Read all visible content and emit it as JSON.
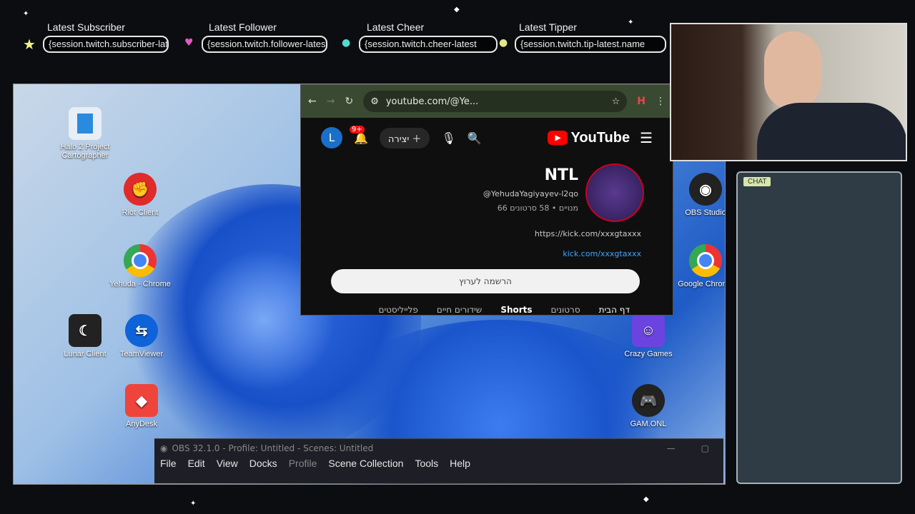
{
  "overlay": {
    "alerts": [
      {
        "title": "Latest Subscriber",
        "value": "{session.twitch.subscriber-latest"
      },
      {
        "title": "Latest Follower",
        "value": "{session.twitch.follower-latest"
      },
      {
        "title": "Latest Cheer",
        "value": "{session.twitch.cheer-latest"
      },
      {
        "title": "Latest Tipper",
        "value": "{session.twitch.tip-latest.name"
      }
    ],
    "accent": "#ffffff"
  },
  "desktop": {
    "icons_left": [
      {
        "label": "Halo 2 Project Cartographer",
        "icon": "halo-icon"
      },
      {
        "label": "Riot Client",
        "icon": "riot-icon"
      },
      {
        "label": "Yehuda - Chrome",
        "icon": "chrome-icon"
      },
      {
        "label": "TeamViewer",
        "icon": "teamviewer-icon"
      },
      {
        "label": "AnyDesk",
        "icon": "anydesk-icon"
      },
      {
        "label": "Lunar Client",
        "icon": "lunar-icon"
      }
    ],
    "icons_right": [
      {
        "label": "OBS Studio",
        "icon": "obs-icon"
      },
      {
        "label": "Google Chrome",
        "icon": "chrome-icon"
      },
      {
        "label": "Crazy Games",
        "icon": "crazygames-icon"
      },
      {
        "label": "GAM.ONL",
        "icon": "gamonl-icon"
      }
    ]
  },
  "browser": {
    "url": "youtube.com/@Ye...",
    "channel_name": "NTL",
    "handle": "@YehudaYagiyayev-l2qo",
    "stats": "66 מנויים • 58 סרטונים",
    "link1": "https://kick.com/xxxgtaxxx",
    "link2": "kick.com/xxxgtaxxx",
    "subscribe_label": "הרשמה לערוץ",
    "create_label": "יצירה",
    "notif_count": "9+",
    "avatar_letter": "L",
    "tabs": [
      "דף הבית",
      "סרטונים",
      "Shorts",
      "שידורים חיים",
      "פלייליסטים"
    ]
  },
  "chat": {
    "label": "CHAT"
  },
  "obs": {
    "title": "OBS 32.1.0 - Profile: Untitled - Scenes: Untitled",
    "menu": [
      "File",
      "Edit",
      "View",
      "Docks",
      "Profile",
      "Scene Collection",
      "Tools",
      "Help"
    ]
  }
}
